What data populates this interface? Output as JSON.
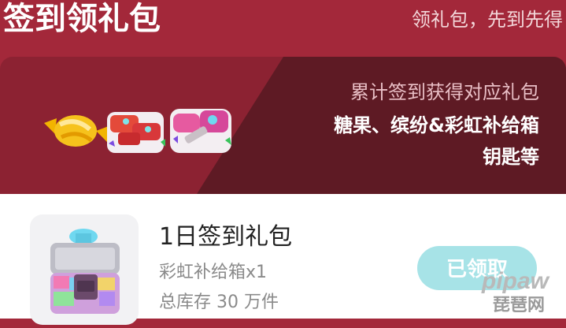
{
  "header": {
    "title": "签到领礼包",
    "subtitle": "领礼包，先到先得"
  },
  "banner": {
    "line1": "累计签到获得对应礼包",
    "line2": "糖果、缤纷&彩虹补给箱",
    "line3": "钥匙等",
    "icons": [
      "candy-icon",
      "colorful-key-icon",
      "rainbow-key-icon"
    ]
  },
  "gift": {
    "name": "1日签到礼包",
    "content": "彩虹补给箱x1",
    "stock": "总库存 30 万件",
    "button_label": "已领取",
    "button_color": "#a7e3e7"
  },
  "watermark": {
    "en": "pipaw",
    "cn": "琵琶网"
  },
  "colors": {
    "header_bg": "#a3283a",
    "banner_bg": "#8c2232",
    "banner_dark": "#5e1a24"
  }
}
